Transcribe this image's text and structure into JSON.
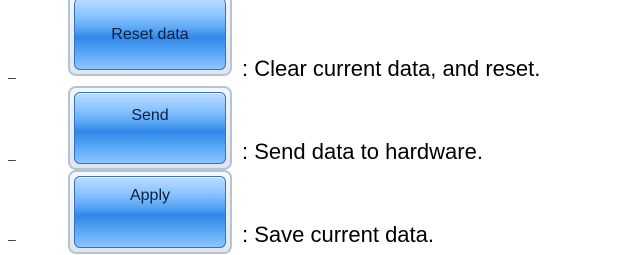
{
  "items": [
    {
      "bullet": "–",
      "button_label": "Reset data",
      "description": ": Clear current data, and reset."
    },
    {
      "bullet": "–",
      "button_label": "Send",
      "description": ": Send data to hardware."
    },
    {
      "bullet": "–",
      "button_label": "Apply",
      "description": ": Save current data."
    }
  ]
}
